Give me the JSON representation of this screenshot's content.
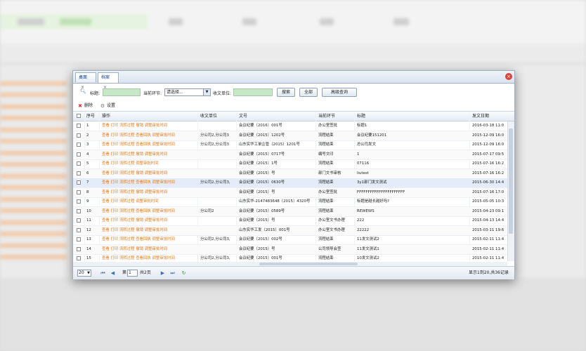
{
  "tabs": [
    {
      "label": "桌面",
      "close": "×"
    },
    {
      "label": "档案",
      "close": "×"
    }
  ],
  "search": {
    "title_label": "标题:",
    "step_label": "当前环节:",
    "step_value": "请选择...",
    "unit_label": "收文单位:",
    "btn_search": "搜索",
    "btn_all": "全部",
    "btn_advanced": "高级查询"
  },
  "toolbar": {
    "delete": "删除",
    "settings": "设置"
  },
  "columns": {
    "no": "序号",
    "ops": "操作",
    "unit": "收文单位",
    "docno": "文号",
    "step": "当前环节",
    "title": "标题",
    "date": "发文日期"
  },
  "rows": [
    {
      "no": "1",
      "ops": "查看 打印 流转过程 撤销 调整审批时间",
      "unit": "",
      "docno": "会议纪要〔2016〕001号",
      "step": "办公室签批",
      "title": "标题1",
      "date": "2016-03-18 11:0"
    },
    {
      "no": "2",
      "ops": "查看 打印 流转过程 查看回执 调整审批时间",
      "unit": "分公司2,分公司3",
      "docno": "会议纪要〔2015〕1202号",
      "step": "流程结束",
      "title": "会议纪要151201",
      "date": "2015-12-09 16:0"
    },
    {
      "no": "3",
      "ops": "查看 打印 流转过程 查看回执 调整审批时间",
      "unit": "分公司2,分公司3",
      "docno": "山东实华工单企管〔2015〕1201号",
      "step": "流程结束",
      "title": "总公司发文",
      "date": "2015-12-09 16:0"
    },
    {
      "no": "4",
      "ops": "查看 打印 流转过程 撤销 调整审批时间",
      "unit": "",
      "docno": "会议纪要〔2015〕0717号",
      "step": "编号文印",
      "title": "1",
      "date": "2015-07-17 09:5"
    },
    {
      "no": "5",
      "ops": "查看 打印 流转过程 调整审批时间",
      "unit": "",
      "docno": "会议纪要〔2015〕1号",
      "step": "流程结束",
      "title": "07116",
      "date": "2015-07-16 16:2"
    },
    {
      "no": "6",
      "ops": "查看 打印 流转过程 撤销 调整审批时间",
      "unit": "",
      "docno": "会议纪要〔2015〕号",
      "step": "部门文书审核",
      "title": "liutest",
      "date": "2015-07-16 16:2"
    },
    {
      "no": "7",
      "ops": "查看 打印 流转过程 查看回执 调整审批时间",
      "unit": "分公司2,分公司3,",
      "docno": "会议纪要〔2015〕0630号",
      "step": "流程结束",
      "title": "3y1部门发文测试",
      "date": "2015-06-30 14:4"
    },
    {
      "no": "8",
      "ops": "查看 打印 流转过程 撤销 调整审批时间",
      "unit": "",
      "docno": "会议纪要〔2015〕号",
      "step": "办公室签批",
      "title": "FFFFFFFFFFFFFFFFFFFFFF",
      "date": "2015-07-16 17:0"
    },
    {
      "no": "9",
      "ops": "查看 打印 流转过程 调整审批时间",
      "unit": "",
      "docno": "山东实华-2147483648〔2015〕4320号",
      "step": "流程结束",
      "title": "标题是越长越好吗?",
      "date": "2015-05-05 10:3"
    },
    {
      "no": "10",
      "ops": "查看 打印 流转过程 查看回执 调整审批时间",
      "unit": "分公司2",
      "docno": "会议纪要〔2015〕0589号",
      "step": "流程结束",
      "title": "REWEWS",
      "date": "2015-04-23 09:1"
    },
    {
      "no": "11",
      "ops": "查看 打印 流转过程 撤销 调整审批时间",
      "unit": "",
      "docno": "会议纪要〔2015〕号",
      "step": "办公室文书办理",
      "title": "222",
      "date": "2015-04-13 14:4"
    },
    {
      "no": "12",
      "ops": "查看 打印 流转过程 撤销 调整审批时间",
      "unit": "",
      "docno": "山东实华工发〔2015〕001号",
      "step": "办公室文书办理",
      "title": "22222",
      "date": "2015-03-11 19:6"
    },
    {
      "no": "13",
      "ops": "查看 打印 流转过程 查看回执 调整审批时间",
      "unit": "分公司2,分公司3,",
      "docno": "会议纪要〔2015〕002号",
      "step": "流程结束",
      "title": "11发文测试2",
      "date": "2015-02-11 11:4"
    },
    {
      "no": "14",
      "ops": "查看 打印 流转过程 撤销 调整审批时间",
      "unit": "",
      "docno": "会议纪要〔2015〕号",
      "step": "公司领导会签",
      "title": "11发文测试1",
      "date": "2015-02-11 11:4"
    },
    {
      "no": "15",
      "ops": "查看 打印 流转过程 查看回执 调整审批时间",
      "unit": "分公司2,分公司3,",
      "docno": "会议纪要〔2015〕001号",
      "step": "流程结束",
      "title": "10发文测试2",
      "date": "2015-02-11 11:4"
    }
  ],
  "pager": {
    "page_size": "20",
    "page_prefix": "第",
    "page_value": "1",
    "page_suffix": "共2页",
    "summary": "显示1到20,共36记录"
  }
}
